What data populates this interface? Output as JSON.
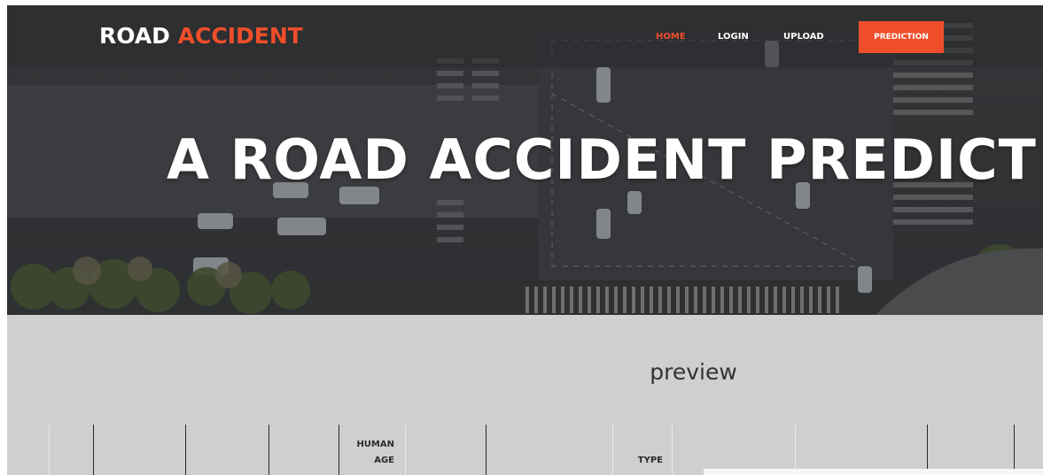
{
  "brand": {
    "part1": "ROAD",
    "part2": "ACCIDENT"
  },
  "nav": {
    "home": "HOME",
    "login": "LOGIN",
    "upload": "UPLOAD",
    "prediction": "PREDICTION"
  },
  "hero": {
    "title": "A ROAD ACCIDENT PREDICT"
  },
  "preview": {
    "title": "preview",
    "headers": [
      {
        "line1": "HUMAN",
        "line2": "AGE"
      },
      {
        "line1": "",
        "line2": "TYPE"
      }
    ]
  },
  "colors": {
    "accent": "#f04e2b",
    "section_bg": "#cfcfcf"
  }
}
